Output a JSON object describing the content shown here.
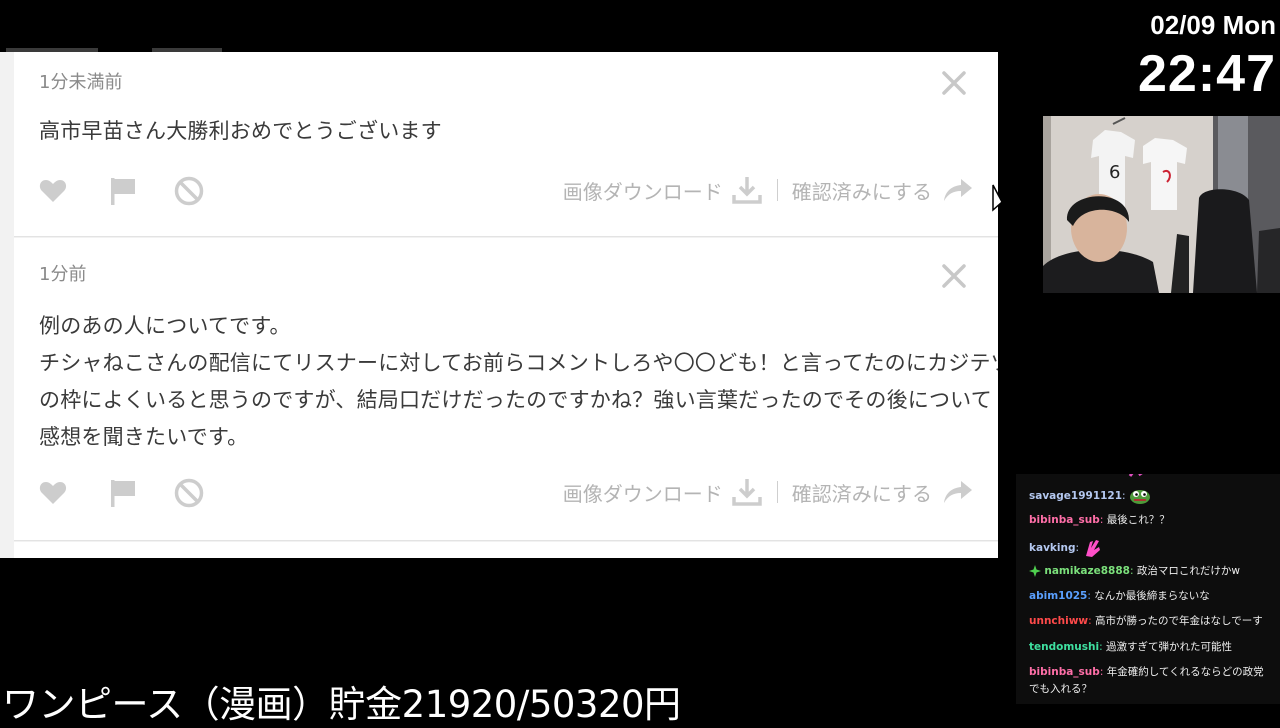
{
  "overlay": {
    "date": "02/09 Mon",
    "time": "22:47",
    "ticker": "ワンピース（漫画）貯金21920/50320円"
  },
  "cards": [
    {
      "time_ago": "1分未満前",
      "message_lines": [
        "高市早苗さん大勝利おめでとうございます"
      ],
      "download_label": "画像ダウンロード",
      "confirm_label": "確認済みにする"
    },
    {
      "time_ago": "1分前",
      "message_lines": [
        "例のあの人についてです。",
        "チシャねこさんの配信にてリスナーに対してお前らコメントしろや〇〇ども！と言ってたのにカジテツさん",
        "の枠によくいると思うのですが、結局口だけだったのですかね？強い言葉だったのでその後について",
        "感想を聞きたいです。"
      ],
      "download_label": "画像ダウンロード",
      "confirm_label": "確認済みにする"
    }
  ],
  "chat": [
    {
      "user": "savage1991121",
      "color": "#b4c8f0",
      "text": "",
      "emote": "pepe-emote"
    },
    {
      "user": "bibinba_sub",
      "color": "#ff6fa8",
      "text": "最後これ？？"
    },
    {
      "user": "kavking",
      "color": "#b4c8f0",
      "text": "",
      "emote": "pink-hand-emote"
    },
    {
      "user": "namikaze8888",
      "color": "#7be07b",
      "text": "政治マロこれだけかw",
      "badge": "sparkle-badge"
    },
    {
      "user": "abim1025",
      "color": "#5aa0ff",
      "text": "なんか最後締まらないな"
    },
    {
      "user": "unnchiww",
      "color": "#ff4a4a",
      "text": "高市が勝ったので年金はなしでーす"
    },
    {
      "user": "tendomushi",
      "color": "#3fe0a0",
      "text": "過激すぎて弾かれた可能性"
    },
    {
      "user": "bibinba_sub",
      "color": "#ff6fa8",
      "text": "年金確約してくれるならどの政党でも入れる？"
    }
  ],
  "colors": {
    "icon_grey": "#c8c8c8",
    "text_dark": "#3a3a3a",
    "muted": "#8a8a8a"
  }
}
